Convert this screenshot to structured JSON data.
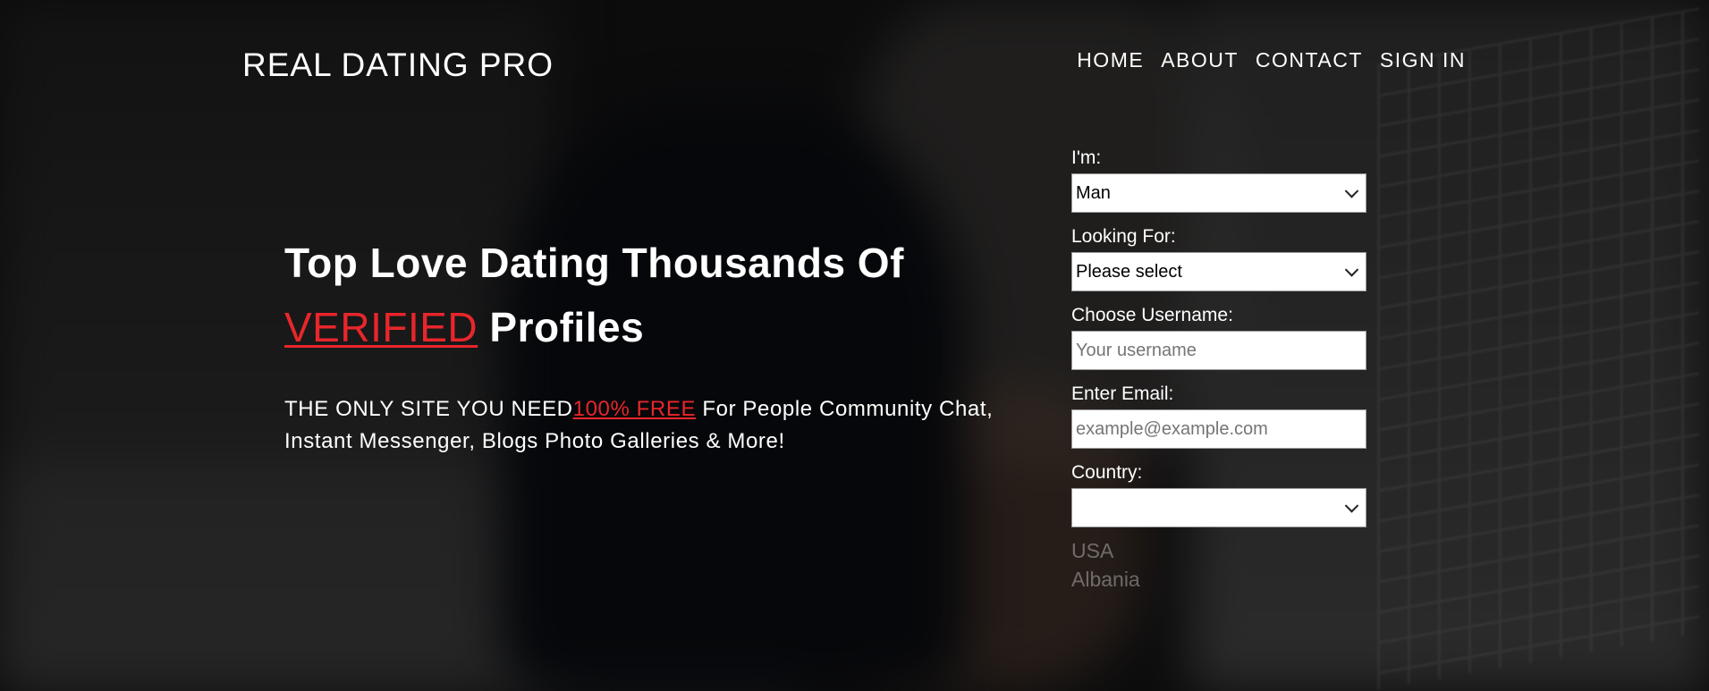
{
  "header": {
    "brand": "REAL DATING PRO",
    "nav": [
      "HOME",
      "ABOUT",
      "CONTACT",
      "SIGN IN"
    ]
  },
  "hero": {
    "title_line1": "Top Love Dating Thousands Of",
    "title_accent": "VERIFIED",
    "title_rest": " Profiles",
    "sub_prefix": "THE ONLY SITE YOU NEED",
    "sub_accent": "100% FREE",
    "sub_rest": " For People Community Chat, Instant Messenger, Blogs Photo Galleries & More!"
  },
  "form": {
    "im_label": "I'm:",
    "im_value": "Man",
    "looking_label": "Looking For:",
    "looking_value": "Please select",
    "username_label": "Choose Username:",
    "username_placeholder": "Your username",
    "email_label": "Enter Email:",
    "email_placeholder": "example@example.com",
    "country_label": "Country:",
    "country_value": "",
    "country_options": [
      "USA",
      "Albania"
    ]
  },
  "colors": {
    "accent": "#e8262b",
    "text": "#ffffff"
  }
}
